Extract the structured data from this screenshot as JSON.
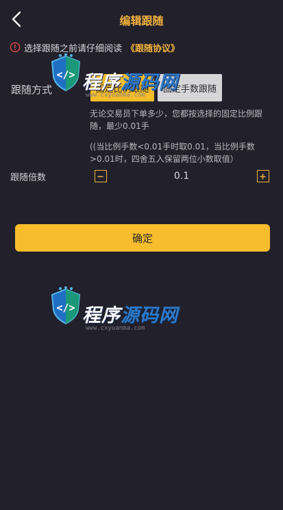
{
  "header": {
    "back_icon": "chevron-left-icon",
    "title": "编辑跟随"
  },
  "notice": {
    "icon": "warning-circle-icon",
    "text": "选择跟随之前请仔细阅读",
    "link": "《跟随协议》"
  },
  "follow_mode": {
    "label": "跟随方式",
    "options": [
      {
        "label": "固定比例跟随",
        "selected": true
      },
      {
        "label": "固定手数跟随",
        "selected": false
      }
    ],
    "description": "无论交易员下单多少，您都按选择的固定比例跟随，最少0.01手",
    "rule": "((当比例手数<0.01手时取0.01，当比例手数>0.01时，四舍五入保留两位小数取值）"
  },
  "multiplier": {
    "label": "跟随倍数",
    "value": "0.1",
    "minus_icon": "minus-icon",
    "plus_icon": "plus-icon"
  },
  "confirm": {
    "label": "确定"
  },
  "watermark": {
    "text_white": "程序",
    "text_blue": "源码网",
    "url": "www.cxyuanma.com"
  },
  "colors": {
    "background": "#22212b",
    "accent": "#f3b33d",
    "primary_button": "#f7bd2c",
    "secondary_button": "#d6d6d9",
    "warning_red": "#e1443f"
  }
}
